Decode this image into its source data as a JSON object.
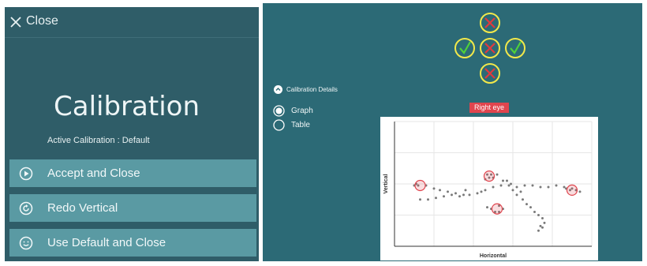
{
  "left_panel": {
    "close_label": "Close",
    "title": "Calibration",
    "active_calibration": "Active Calibration : Default",
    "buttons": [
      {
        "label": "Accept and Close",
        "icon": "play-circle-icon"
      },
      {
        "label": "Redo Vertical",
        "icon": "redo-circle-icon"
      },
      {
        "label": "Use Default and Close",
        "icon": "smile-circle-icon"
      }
    ]
  },
  "right_panel": {
    "targets": [
      {
        "name": "target-top",
        "status": "fail"
      },
      {
        "name": "target-left",
        "status": "pass"
      },
      {
        "name": "target-center",
        "status": "fail"
      },
      {
        "name": "target-right",
        "status": "pass"
      },
      {
        "name": "target-bottom",
        "status": "fail"
      }
    ],
    "details_label": "Calibration Details",
    "view_options": [
      {
        "label": "Graph",
        "selected": true
      },
      {
        "label": "Table",
        "selected": false
      }
    ],
    "eye_badge": "Right eye"
  },
  "chart_data": {
    "type": "scatter",
    "xlabel": "Horizontal",
    "ylabel": "Vertical",
    "xlim": [
      0,
      10
    ],
    "ylim": [
      0,
      8
    ],
    "grid": true,
    "series": [
      {
        "points": [
          [
            1.2,
            3.9
          ],
          [
            1.6,
            3.9
          ],
          [
            2.0,
            3.7
          ],
          [
            2.3,
            3.6
          ],
          [
            2.7,
            3.5
          ],
          [
            3.1,
            3.4
          ],
          [
            3.5,
            3.3
          ],
          [
            3.8,
            3.3
          ],
          [
            4.2,
            3.4
          ],
          [
            4.6,
            3.6
          ],
          [
            5.0,
            3.8
          ],
          [
            5.4,
            3.9
          ],
          [
            5.8,
            3.9
          ],
          [
            6.2,
            3.8
          ],
          [
            6.6,
            3.9
          ],
          [
            7.0,
            3.9
          ],
          [
            7.4,
            3.8
          ],
          [
            7.8,
            3.8
          ],
          [
            8.2,
            3.9
          ],
          [
            8.6,
            3.8
          ],
          [
            9.0,
            3.7
          ],
          [
            1.3,
            3.0
          ],
          [
            1.7,
            3.0
          ],
          [
            2.1,
            3.1
          ],
          [
            2.5,
            3.2
          ],
          [
            2.9,
            3.3
          ],
          [
            3.3,
            3.2
          ],
          [
            4.6,
            4.3
          ],
          [
            4.7,
            4.6
          ],
          [
            4.8,
            4.4
          ],
          [
            4.9,
            4.6
          ],
          [
            5.0,
            4.4
          ],
          [
            5.2,
            4.6
          ],
          [
            5.5,
            4.2
          ],
          [
            5.7,
            4.2
          ],
          [
            5.9,
            4.0
          ],
          [
            4.7,
            2.5
          ],
          [
            4.9,
            2.4
          ],
          [
            5.1,
            2.2
          ],
          [
            5.3,
            2.6
          ],
          [
            5.5,
            2.4
          ],
          [
            5.3,
            2.2
          ],
          [
            6.2,
            3.3
          ],
          [
            6.5,
            3.0
          ],
          [
            6.7,
            2.7
          ],
          [
            6.9,
            2.5
          ],
          [
            7.1,
            2.2
          ],
          [
            7.3,
            2.0
          ],
          [
            7.5,
            1.8
          ],
          [
            7.6,
            1.5
          ],
          [
            7.4,
            1.3
          ],
          [
            7.3,
            1.0
          ],
          [
            7.5,
            1.2
          ],
          [
            8.7,
            3.7
          ],
          [
            8.9,
            3.6
          ],
          [
            9.2,
            3.6
          ],
          [
            9.4,
            3.5
          ],
          [
            1.0,
            3.9
          ],
          [
            1.1,
            4.0
          ],
          [
            3.6,
            3.6
          ],
          [
            6.0,
            3.6
          ],
          [
            6.4,
            3.5
          ],
          [
            4.4,
            3.5
          ]
        ]
      }
    ],
    "highlights": [
      [
        1.3,
        3.9
      ],
      [
        4.8,
        4.5
      ],
      [
        5.2,
        2.4
      ],
      [
        9.0,
        3.6
      ]
    ]
  }
}
